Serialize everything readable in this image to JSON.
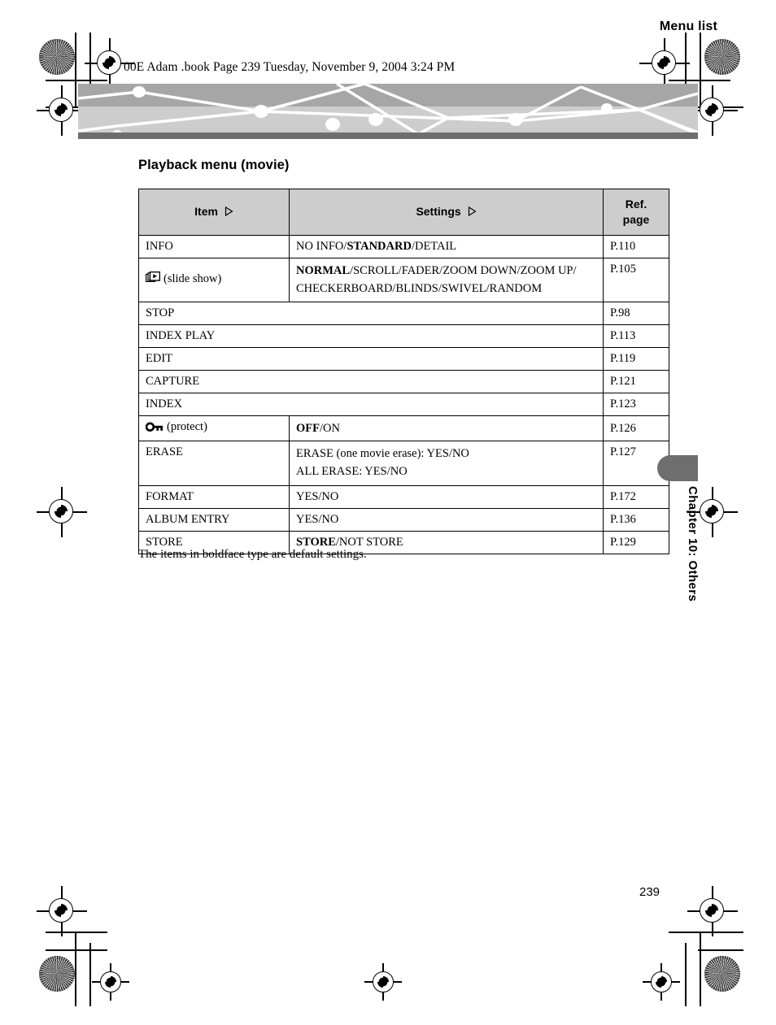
{
  "print_header": {
    "text": "00E Adam .book  Page 239  Tuesday, November 9, 2004  3:24 PM"
  },
  "banner": {
    "title": "Menu list",
    "colors": {
      "top": "#a6a6a6",
      "bottom": "#cdcdcd",
      "base": "#6e6e6e",
      "lines": "#ffffff"
    }
  },
  "section": {
    "title": "Playback menu (movie)"
  },
  "table": {
    "headers": {
      "item": "Item",
      "item_glyph": "triangle-right-icon",
      "settings": "Settings",
      "settings_glyph": "triangle-right-icon",
      "ref_line1": "Ref.",
      "ref_line2": "page"
    },
    "rows": [
      {
        "item": "INFO",
        "icon": null,
        "settings_plain_pre": "NO INFO/",
        "settings_bold": "STANDARD",
        "settings_plain_post": "/DETAIL",
        "settings_line2": "",
        "ref": "P.110",
        "span": false
      },
      {
        "item": "(slide show)",
        "icon": "slideshow-icon",
        "settings_plain_pre": "",
        "settings_bold": "NORMAL",
        "settings_plain_post": "/SCROLL/FADER/ZOOM DOWN/ZOOM UP/",
        "settings_line2": "CHECKERBOARD/BLINDS/SWIVEL/RANDOM",
        "ref": "P.105",
        "span": false
      },
      {
        "item": "STOP",
        "icon": null,
        "settings_plain_pre": "",
        "settings_bold": "",
        "settings_plain_post": "",
        "settings_line2": "",
        "ref": "P.98",
        "span": true
      },
      {
        "item": "INDEX PLAY",
        "icon": null,
        "settings_plain_pre": "",
        "settings_bold": "",
        "settings_plain_post": "",
        "settings_line2": "",
        "ref": "P.113",
        "span": true
      },
      {
        "item": "EDIT",
        "icon": null,
        "settings_plain_pre": "",
        "settings_bold": "",
        "settings_plain_post": "",
        "settings_line2": "",
        "ref": "P.119",
        "span": true
      },
      {
        "item": "CAPTURE",
        "icon": null,
        "settings_plain_pre": "",
        "settings_bold": "",
        "settings_plain_post": "",
        "settings_line2": "",
        "ref": "P.121",
        "span": true
      },
      {
        "item": "INDEX",
        "icon": null,
        "settings_plain_pre": "",
        "settings_bold": "",
        "settings_plain_post": "",
        "settings_line2": "",
        "ref": "P.123",
        "span": true
      },
      {
        "item": "(protect)",
        "icon": "key-icon",
        "settings_plain_pre": "",
        "settings_bold": "OFF",
        "settings_plain_post": "/ON",
        "settings_line2": "",
        "ref": "P.126",
        "span": false
      },
      {
        "item": "ERASE",
        "icon": null,
        "settings_plain_pre": "ERASE (one movie erase): YES/NO",
        "settings_bold": "",
        "settings_plain_post": "",
        "settings_line2": "ALL ERASE: YES/NO",
        "ref": "P.127",
        "span": false
      },
      {
        "item": "FORMAT",
        "icon": null,
        "settings_plain_pre": "YES/NO",
        "settings_bold": "",
        "settings_plain_post": "",
        "settings_line2": "",
        "ref": "P.172",
        "span": false
      },
      {
        "item": "ALBUM ENTRY",
        "icon": null,
        "settings_plain_pre": "YES/NO",
        "settings_bold": "",
        "settings_plain_post": "",
        "settings_line2": "",
        "ref": "P.136",
        "span": false
      },
      {
        "item": "STORE",
        "icon": null,
        "settings_plain_pre": "",
        "settings_bold": "STORE",
        "settings_plain_post": "/NOT STORE",
        "settings_line2": "",
        "ref": "P.129",
        "span": false
      }
    ]
  },
  "note": {
    "text": "The items in boldface type are default settings."
  },
  "chapter_tab": {
    "label": "Chapter 10: Others",
    "color": "#6e6e6e"
  },
  "page_number": "239"
}
